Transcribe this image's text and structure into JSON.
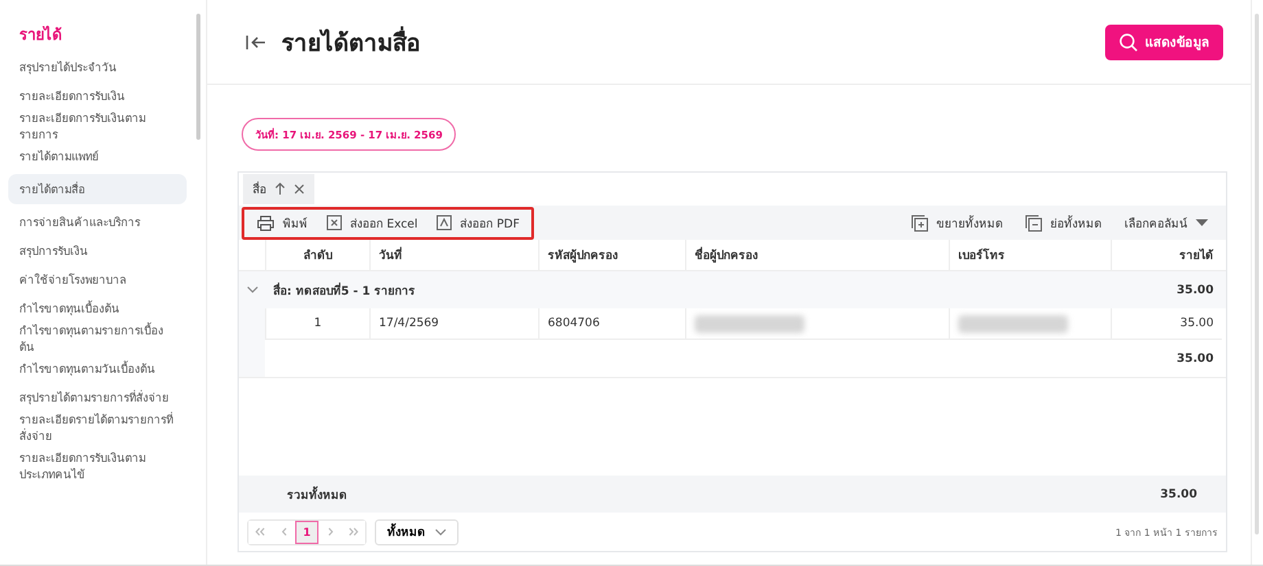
{
  "sidebar": {
    "heading": "รายได้",
    "sections": [
      {
        "items": [
          {
            "label": "สรุปรายได้ประจำวัน",
            "selected": false
          }
        ]
      },
      {
        "items": [
          {
            "label": "รายละเอียดการรับเงิน",
            "selected": false
          },
          {
            "label": "รายละเอียดการรับเงินตามรายการ",
            "selected": false
          },
          {
            "label": "รายได้ตามแพทย์",
            "selected": false
          }
        ]
      },
      {
        "items": [
          {
            "label": "รายได้ตามสื่อ",
            "selected": true
          }
        ]
      },
      {
        "items": [
          {
            "label": "การจ่ายสินค้าและบริการ",
            "selected": false
          }
        ]
      },
      {
        "items": [
          {
            "label": "สรุปการรับเงิน",
            "selected": false
          }
        ]
      },
      {
        "items": [
          {
            "label": "ค่าใช้จ่ายโรงพยาบาล",
            "selected": false
          }
        ]
      },
      {
        "items": [
          {
            "label": "กำไรขาดทุนเบื้องต้น",
            "selected": false
          },
          {
            "label": "กำไรขาดทุนตามรายการเบื้องต้น",
            "selected": false
          },
          {
            "label": "กำไรขาดทุนตามวันเบื้องต้น",
            "selected": false
          }
        ]
      },
      {
        "items": [
          {
            "label": "สรุปรายได้ตามรายการที่สั่งจ่าย",
            "selected": false
          },
          {
            "label": "รายละเอียดรายได้ตามรายการที่สั่งจ่าย",
            "selected": false
          },
          {
            "label": "รายละเอียดการรับเงินตามประเภทคนไข้",
            "selected": false
          }
        ]
      }
    ]
  },
  "header": {
    "title": "รายได้ตามสื่อ",
    "button": "แสดงข้อมูล"
  },
  "date_range": "วันที่: 17 เม.ย. 2569 - 17 เม.ย. 2569",
  "table": {
    "group_by": {
      "label": "สื่อ"
    },
    "toolbar_left": [
      {
        "kind": "print",
        "label": "พิมพ์"
      },
      {
        "kind": "excel",
        "label": "ส่งออก Excel"
      },
      {
        "kind": "pdf",
        "label": "ส่งออก PDF"
      }
    ],
    "toolbar_right": [
      {
        "kind": "expand",
        "label": "ขยายทั้งหมด"
      },
      {
        "kind": "collapse",
        "label": "ย่อทั้งหมด"
      },
      {
        "kind": "columns",
        "label": "เลือกคอลัมน์"
      }
    ],
    "columns": [
      "ลำดับ",
      "วันที่",
      "รหัสผู้ปกครอง",
      "ชื่อผู้ปกครอง",
      "เบอร์โทร",
      "รายได้"
    ],
    "groups": [
      {
        "label": "สื่อ: ทดสอบที่5 - 1 รายการ",
        "total": "35.00",
        "expanded": true,
        "rows": [
          {
            "cells": [
              {
                "kind": "text",
                "text": "1"
              },
              {
                "kind": "text",
                "text": "17/4/2569"
              },
              {
                "kind": "text",
                "text": "6804706"
              },
              {
                "kind": "blurred"
              },
              {
                "kind": "blurred"
              },
              {
                "kind": "text",
                "text": "35.00"
              }
            ]
          }
        ],
        "subtotal": "35.00"
      }
    ],
    "grand_total": {
      "label": "รวมทั้งหมด",
      "value": "35.00"
    },
    "pagination": {
      "pages": [
        {
          "label": "1",
          "selected": true
        }
      ],
      "page_size": "ทั้งหมด",
      "info": "1 จาก 1 หน้า 1 รายการ"
    }
  }
}
